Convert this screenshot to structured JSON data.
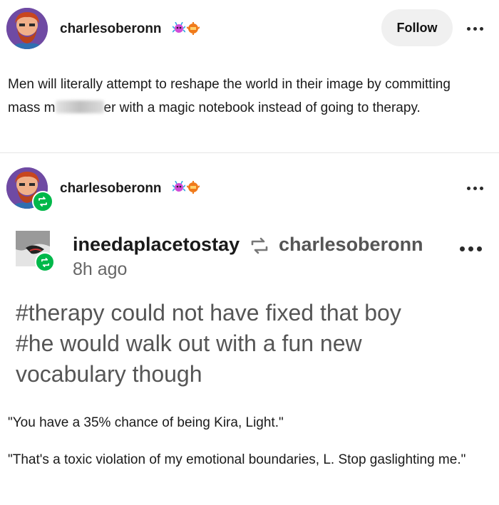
{
  "post": {
    "username": "charlesoberonn",
    "follow_label": "Follow",
    "text_before": "Men will literally attempt to reshape the world in their image by committing mass m",
    "text_after": "er with a magic notebook instead of going to therapy."
  },
  "reblog": {
    "username": "charlesoberonn",
    "source": {
      "username": "ineedaplacetostay",
      "reblogged_from": "charlesoberonn",
      "time": "8h ago"
    },
    "tags": "#therapy could not have fixed that boy #he would walk out with a fun new vocabulary though",
    "quotes": [
      "\"You have a 35% chance of being Kira, Light.\"",
      "\"That's a toxic violation of my emotional boundaries, L. Stop gaslighting me.\""
    ]
  },
  "colors": {
    "reblog_green": "#00b84a",
    "follow_bg": "#f0f0f0",
    "avatar_bg": "#6f4aa3"
  },
  "icons": [
    "avatar",
    "badge-icon",
    "more-options-icon",
    "reblog-icon"
  ]
}
